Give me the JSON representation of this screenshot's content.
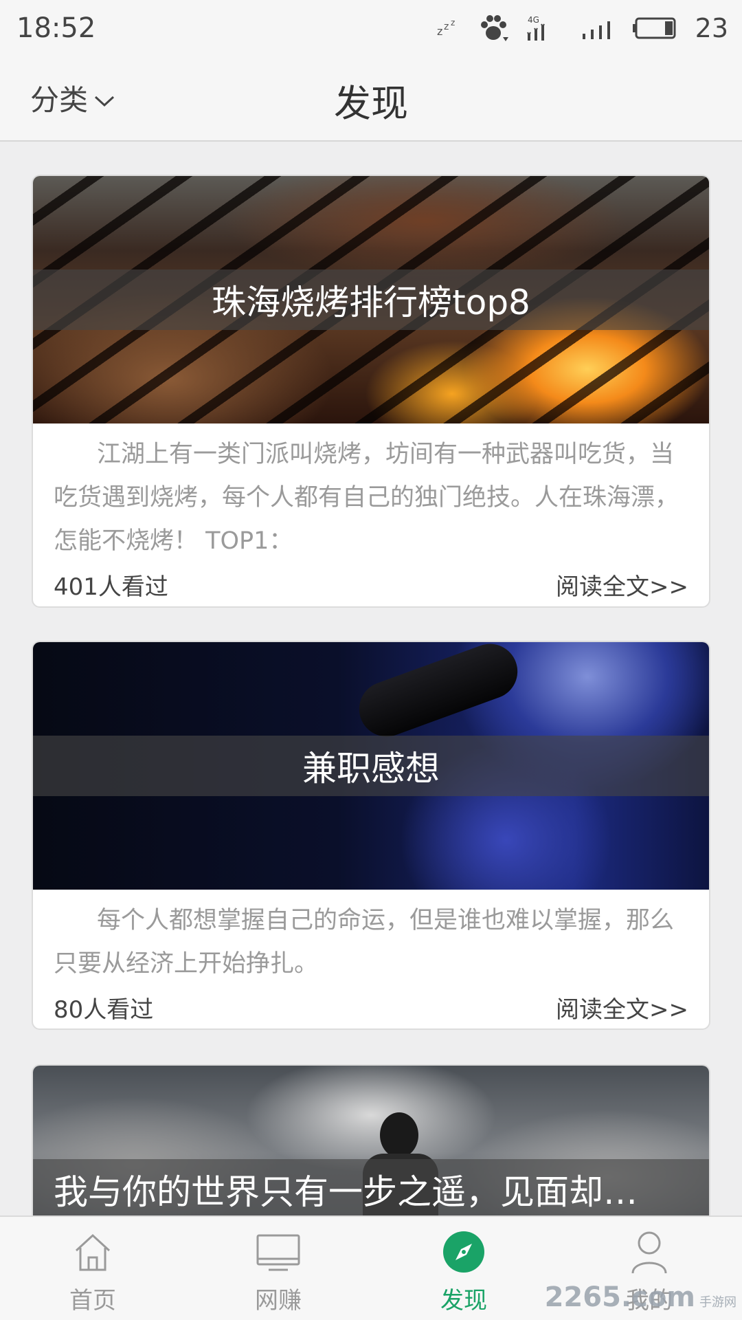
{
  "status_bar": {
    "time": "18:52",
    "network": "4G",
    "battery": "23",
    "icons": [
      "sleep-zzz-icon",
      "paw-icon",
      "signal-4g-icon",
      "signal-icon",
      "battery-icon"
    ]
  },
  "header": {
    "category_label": "分类",
    "title": "发现"
  },
  "feed": {
    "articles": [
      {
        "title": "珠海烧烤排行榜top8",
        "description": "江湖上有一类门派叫烧烤，坊间有一种武器叫吃货，当吃货遇到烧烤，每个人都有自己的独门绝技。人在珠海漂，怎能不烧烤！ TOP1：",
        "views": "401人看过",
        "read_more": "阅读全文>>"
      },
      {
        "title": "兼职感想",
        "description": "每个人都想掌握自己的命运，但是谁也难以掌握，那么只要从经济上开始挣扎。",
        "views": "80人看过",
        "read_more": "阅读全文>>"
      },
      {
        "title": "我与你的世界只有一步之遥，见面却…"
      }
    ]
  },
  "bottom_nav": {
    "items": [
      {
        "label": "首页",
        "icon": "home-icon",
        "active": false
      },
      {
        "label": "网赚",
        "icon": "monitor-icon",
        "active": false
      },
      {
        "label": "发现",
        "icon": "compass-icon",
        "active": true
      },
      {
        "label": "我的",
        "icon": "user-icon",
        "active": false
      }
    ]
  },
  "watermark": {
    "text": "2265.com",
    "sub": "手游网"
  },
  "colors": {
    "accent": "#1aa367",
    "background": "#eeeeef",
    "inactive": "#9a9a9a"
  }
}
